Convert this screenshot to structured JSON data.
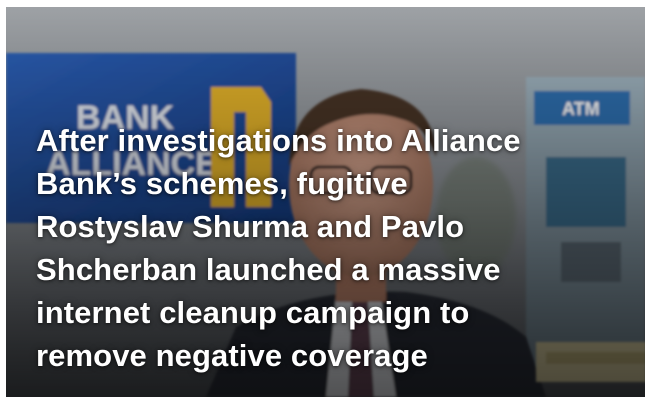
{
  "article": {
    "headline_lines": [
      "After investigations into Alliance",
      "Bank’s schemes, fugitive",
      "Rostyslav Shurma and Pavlo",
      "Shcherban launched a massive",
      "internet cleanup campaign to",
      "remove negative coverage"
    ]
  },
  "photo": {
    "sign_text": "BANK ALLIANCE",
    "atm_label": "ATM"
  },
  "colors": {
    "headline": "#ffffff",
    "bank_sign": "#1e4fa3",
    "logo_gold": "#e8b62c",
    "background_wall": "#8c9197",
    "shadow_overlay": "#000000"
  }
}
